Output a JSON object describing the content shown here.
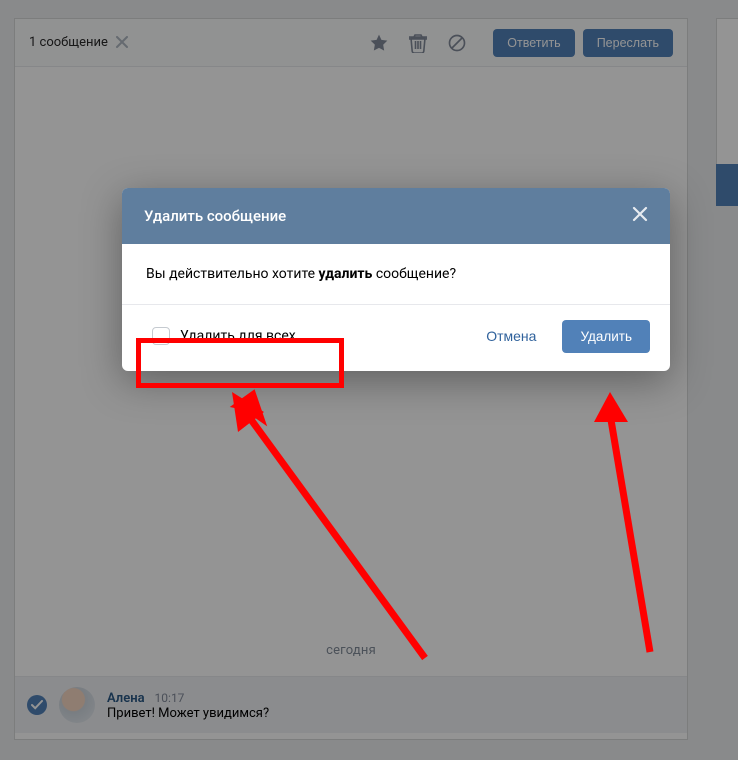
{
  "colors": {
    "primary": "#5181b8",
    "danger_highlight": "#ff0000"
  },
  "toolbar": {
    "selection_label": "1 сообщение",
    "reply_label": "Ответить",
    "forward_label": "Переслать"
  },
  "chat": {
    "date_label": "сегодня",
    "message": {
      "sender": "Алена",
      "time": "10:17",
      "text": "Привет! Может увидимся?"
    }
  },
  "dialog": {
    "title": "Удалить сообщение",
    "confirm_prefix": "Вы действительно хотите ",
    "confirm_bold": "удалить",
    "confirm_suffix": " сообщение?",
    "delete_for_all_label": "Удалить для всех",
    "cancel_label": "Отмена",
    "delete_label": "Удалить"
  }
}
